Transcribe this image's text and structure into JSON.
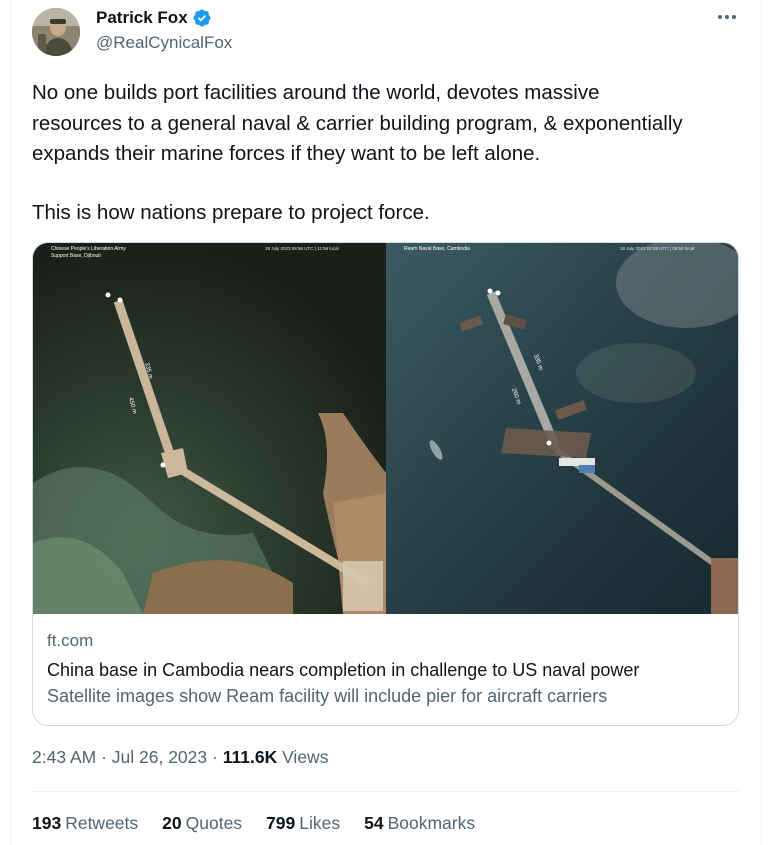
{
  "author": {
    "name": "Patrick Fox",
    "handle": "@RealCynicalFox",
    "verified": true,
    "verified_color": "#1d9bf0"
  },
  "more_icon": "more-horizontal-icon",
  "tweet_text": [
    "No one builds port facilities around the world, devotes massive\nresources to a general naval & carrier building program, & exponentially\nexpands their marine forces if they want to be left alone.",
    "This is how nations prepare to project force."
  ],
  "card": {
    "image_left": {
      "caption_line1": "Chinese People's Liberation Army",
      "caption_line2": "Support Base, Djibouti",
      "timestamp": "18 July 2023 08:56 UTC | 11:56 local",
      "measure_a": "335 m",
      "measure_b": "450 m"
    },
    "image_right": {
      "caption_line1": "Ream Naval Base, Cambodia",
      "timestamp": "18 July 2023 02:58 UTC | 09:58 local",
      "measure_a": "335 m",
      "measure_b": "260 m"
    },
    "domain": "ft.com",
    "title": "China base in Cambodia nears completion in challenge to US naval power",
    "description": "Satellite images show Ream facility will include pier for aircraft carriers"
  },
  "meta": {
    "time": "2:43 AM",
    "separator": " · ",
    "date": "Jul 26, 2023",
    "views_count": "111.6K",
    "views_label": "Views"
  },
  "stats": [
    {
      "count": "193",
      "label": "Retweets"
    },
    {
      "count": "20",
      "label": "Quotes"
    },
    {
      "count": "799",
      "label": "Likes"
    },
    {
      "count": "54",
      "label": "Bookmarks"
    }
  ]
}
